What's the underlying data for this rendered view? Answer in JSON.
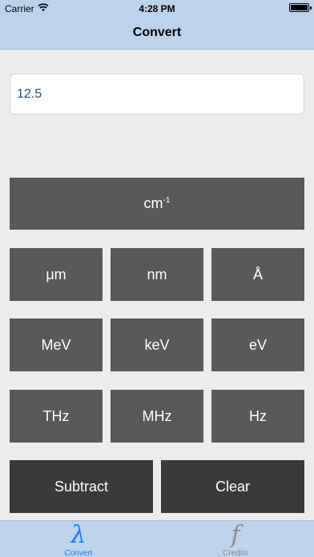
{
  "status": {
    "carrier": "Carrier",
    "time": "4:28 PM"
  },
  "nav": {
    "title": "Convert"
  },
  "input": {
    "value": "12.5"
  },
  "units": {
    "wavenumber": {
      "base": "cm",
      "exp": "-1"
    },
    "um": "μm",
    "nm": "nm",
    "angstrom": "Å",
    "mev": "MeV",
    "kev": "keV",
    "ev": "eV",
    "thz": "THz",
    "mhz": "MHz",
    "hz": "Hz"
  },
  "actions": {
    "subtract": "Subtract",
    "clear": "Clear"
  },
  "tabs": [
    {
      "glyph": "λ",
      "label": "Convert",
      "active": true
    },
    {
      "glyph": "f",
      "label": "Credits",
      "active": false
    }
  ],
  "colors": {
    "bar": "#bcd3ec",
    "button": "#595959",
    "button_dark": "#3a3a3a",
    "tab_active": "#1a7ef5",
    "tab_inactive": "#8c8c8c"
  }
}
